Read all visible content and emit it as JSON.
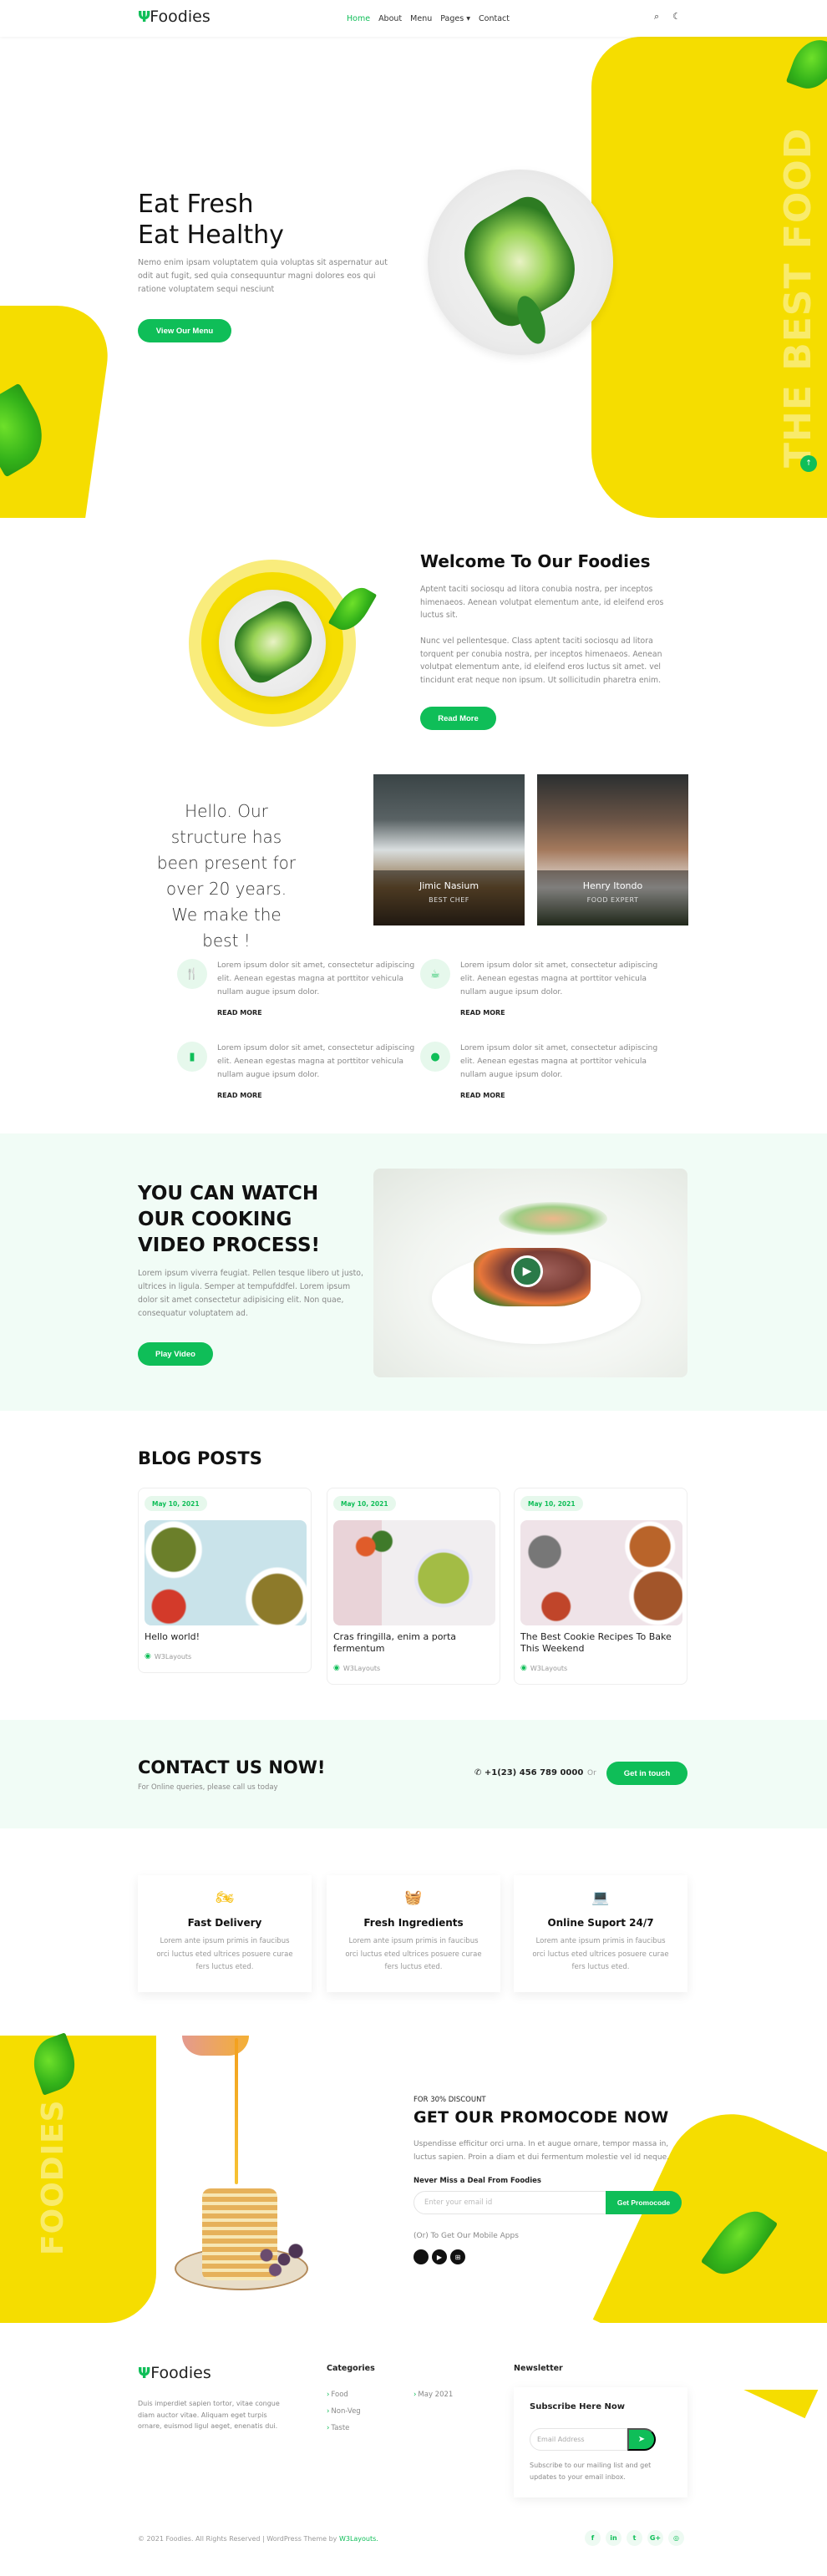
{
  "header": {
    "logo": "Foodies",
    "nav": [
      {
        "label": "Home",
        "active": true
      },
      {
        "label": "About"
      },
      {
        "label": "Menu"
      },
      {
        "label": "Pages ▾"
      },
      {
        "label": "Contact"
      }
    ],
    "search_icon": "⌕",
    "theme_icon": "☾"
  },
  "hero": {
    "title_line1": "Eat Fresh",
    "title_line2": "Eat Healthy",
    "text": "Nemo enim ipsam voluptatem quia voluptas sit aspernatur aut odit aut fugit, sed quia consequuntur magni dolores eos qui ratione voluptatem sequi nesciunt",
    "button": "View Our Menu",
    "vertical_text": "THE BEST FOOD",
    "back_to_top": "↑"
  },
  "welcome": {
    "title_prefix": "Welcome To Our ",
    "title_bold": "Foodies",
    "p1": "Aptent taciti sociosqu ad litora conubia nostra, per inceptos himenaeos. Aenean volutpat elementum ante, id eleifend eros luctus sit.",
    "p2": "Nunc vel pellentesque. Class aptent taciti sociosqu ad litora torquent per conubia nostra, per inceptos himenaeos. Aenean volutpat elementum ante, id eleifend eros luctus sit amet. vel tincidunt erat neque non ipsum. Ut sollicitudin pharetra enim.",
    "button": "Read More"
  },
  "team": {
    "intro": "Hello. Our structure has been present for over 20 years. We make the best !",
    "members": [
      {
        "name": "Jimic Nasium",
        "role": "BEST CHEF"
      },
      {
        "name": "Henry Itondo",
        "role": "FOOD EXPERT"
      }
    ]
  },
  "features": [
    {
      "icon": "🍴",
      "text": "Lorem ipsum dolor sit amet, consectetur adipiscing elit. Aenean egestas magna at porttitor vehicula nullam augue ipsum dolor.",
      "link": "READ MORE"
    },
    {
      "icon": "☕",
      "text": "Lorem ipsum dolor sit amet, consectetur adipiscing elit. Aenean egestas magna at porttitor vehicula nullam augue ipsum dolor.",
      "link": "READ MORE"
    },
    {
      "icon": "▮",
      "text": "Lorem ipsum dolor sit amet, consectetur adipiscing elit. Aenean egestas magna at porttitor vehicula nullam augue ipsum dolor.",
      "link": "READ MORE"
    },
    {
      "icon": "●",
      "text": "Lorem ipsum dolor sit amet, consectetur adipiscing elit. Aenean egestas magna at porttitor vehicula nullam augue ipsum dolor.",
      "link": "READ MORE"
    }
  ],
  "video": {
    "title": "YOU CAN WATCH OUR COOKING VIDEO PROCESS!",
    "text": "Lorem ipsum viverra feugiat. Pellen tesque libero ut justo, ultrices in ligula. Semper at tempufddfel. Lorem ipsum dolor sit amet consectetur adipisicing elit. Non quae, consequatur voluptatem ad.",
    "button": "Play Video",
    "play_icon": "▶"
  },
  "blog": {
    "title": "BLOG POSTS",
    "posts": [
      {
        "date": "May 10, 2021",
        "title": "Hello world!",
        "author": "W3Layouts"
      },
      {
        "date": "May 10, 2021",
        "title": "Cras fringilla, enim a porta fermentum",
        "author": "W3Layouts"
      },
      {
        "date": "May 10, 2021",
        "title": "The Best Cookie Recipes To Bake This Weekend",
        "author": "W3Layouts"
      }
    ]
  },
  "contact": {
    "title": "CONTACT US NOW!",
    "subtitle": "For Online queries, please call us today",
    "phone": "✆ +1(23) 456 789 0000",
    "or": "Or",
    "button": "Get in touch"
  },
  "services": [
    {
      "icon": "🏍",
      "title": "Fast Delivery",
      "text": "Lorem ante ipsum primis in faucibus orci luctus eted ultrices posuere curae fers luctus eted."
    },
    {
      "icon": "🧺",
      "title": "Fresh Ingredients",
      "text": "Lorem ante ipsum primis in faucibus orci luctus eted ultrices posuere curae fers luctus eted."
    },
    {
      "icon": "💻",
      "title": "Online Suport 24/7",
      "text": "Lorem ante ipsum primis in faucibus orci luctus eted ultrices posuere curae fers luctus eted."
    }
  ],
  "promo": {
    "vertical_text": "FOODIES",
    "kicker": "FOR 30% DISCOUNT",
    "title": "GET OUR PROMOCODE NOW",
    "text": "Uspendisse efficitur orci urna. In et augue ornare, tempor massa in, luctus sapien. Proin a diam et dui fermentum molestie vel id neque.",
    "label": "Never Miss a Deal From Foodies",
    "email_placeholder": "Enter your email id",
    "button": "Get Promocode",
    "apps_text": "(Or) To Get Our Mobile Apps",
    "apps": [
      "",
      "▶",
      "⊞"
    ]
  },
  "footer": {
    "logo": "Foodies",
    "about": "Duis imperdiet sapien tortor, vitae congue diam auctor vitae. Aliquam eget turpis ornare, euismod ligul aeget, enenatis dui.",
    "categories_title": "Categories",
    "categories": [
      "Food",
      "Non-Veg",
      "Taste"
    ],
    "archives": [
      "May 2021"
    ],
    "newsletter_title": "Newsletter",
    "subscribe_title": "Subscribe Here Now",
    "email_placeholder": "Email Address",
    "send_icon": "➤",
    "subscribe_text": "Subscribe to our mailing list and get updates to your email inbox.",
    "copyright_prefix": "© 2021 Foodies. All Rights Reserved | WordPress Theme by ",
    "copyright_link": "W3Layouts.",
    "socials": [
      "f",
      "in",
      "t",
      "G+",
      "◎"
    ]
  },
  "colors": {
    "accent": "#0fbe58",
    "yellow": "#f5dd00",
    "service_icon": "#f7c118",
    "tint_bg": "#f1fcf6"
  }
}
